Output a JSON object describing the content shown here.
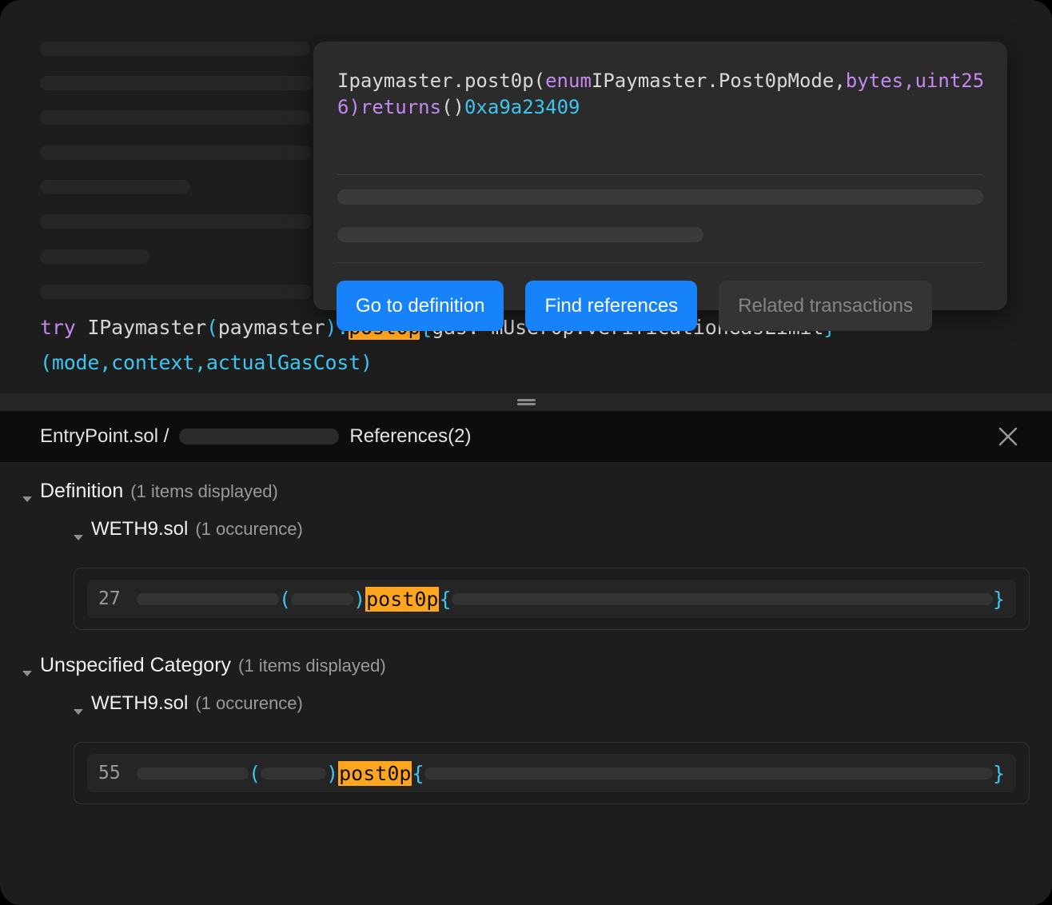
{
  "hover_card": {
    "signature": {
      "prefix": "Ipaymaster.post0p(",
      "type1": "enum",
      "mid1": "IPaymaster.Post0pMode,",
      "type2": "bytes",
      "comma": ",",
      "type3": "uint256",
      "close_paren": ")",
      "returns": "returns",
      "empty_parens": "()",
      "address": "0xa9a23409",
      "full_text": "Ipaymaster.post0p(enumIPaymaster.Post0pMode,bytes,uint256)returns()0xa9a23409"
    },
    "buttons": [
      {
        "label": "Go to definition",
        "state": "enabled"
      },
      {
        "label": "Find references",
        "state": "enabled"
      },
      {
        "label": "Related transactions",
        "state": "disabled"
      }
    ]
  },
  "editor": {
    "code_line_1": {
      "kw_try": "try",
      "space": " ",
      "ident": "IPaymaster",
      "paren_open": "(",
      "param": "paymaster",
      "paren_close": ")",
      "dot": ".",
      "match": "post0p",
      "brace_open": "{",
      "rest": "gas: mUser0p.verificationGasLimit",
      "brace_close": "}"
    },
    "code_line_2": {
      "paren_open": "(",
      "args": "mode,context,actualGasCost",
      "paren_close": ")"
    }
  },
  "references_panel": {
    "breadcrumb": "EntryPoint.sol /",
    "title": "References(2)",
    "close_icon": "close-icon",
    "groups": [
      {
        "name": "Definition",
        "count_label": "(1 items displayed)",
        "files": [
          {
            "name": "WETH9.sol",
            "count_label": "(1 occurence)",
            "results": [
              {
                "line_number": "27",
                "match_text": "post0p",
                "paren_open": "(",
                "paren_close": ")",
                "brace_open": "{",
                "brace_close": "}"
              }
            ]
          }
        ]
      },
      {
        "name": "Unspecified Category",
        "count_label": "(1 items displayed)",
        "files": [
          {
            "name": "WETH9.sol",
            "count_label": "(1 occurence)",
            "results": [
              {
                "line_number": "55",
                "match_text": "post0p",
                "paren_open": "(",
                "paren_close": ")",
                "brace_open": "{",
                "brace_close": "}"
              }
            ]
          }
        ]
      }
    ]
  },
  "colors": {
    "accent_blue": "#1683fb",
    "highlight_orange": "#ffa520",
    "keyword_purple": "#c588f0",
    "punctuation_cyan": "#3ec5ef",
    "panel_bg": "#1d1d1d",
    "header_bg": "#0d0d0d"
  }
}
